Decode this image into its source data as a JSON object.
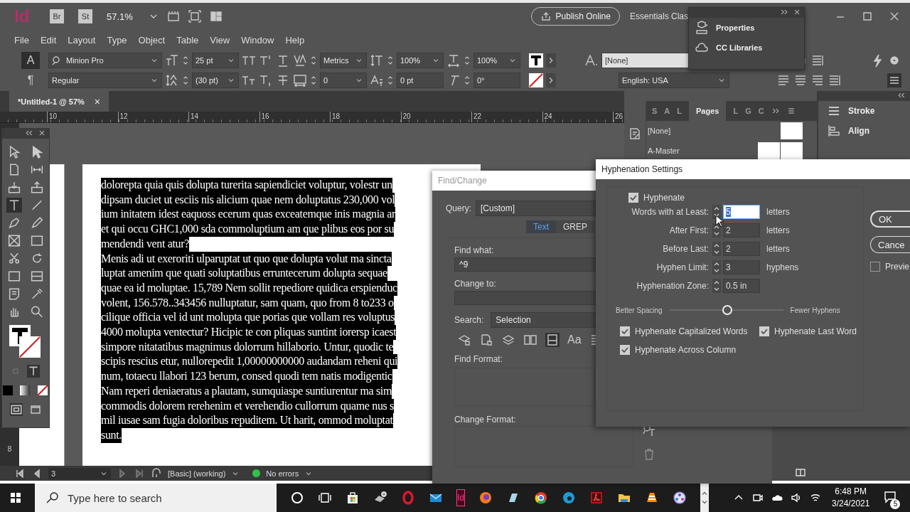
{
  "app_bar": {
    "logo": "Id",
    "bridge": "Br",
    "stock": "St",
    "zoom": "57.1%",
    "publish": "Publish Online",
    "workspace": "Essentials Clas"
  },
  "menu": [
    "File",
    "Edit",
    "Layout",
    "Type",
    "Object",
    "Table",
    "View",
    "Window",
    "Help"
  ],
  "control_panel": {
    "char_mode": "A",
    "para_mode": "¶",
    "font": "Minion Pro",
    "style": "Regular",
    "size": "25 pt",
    "leading": "(30 pt)",
    "kerning": "Metrics",
    "tracking": "0",
    "vertical_scale": "100%",
    "horizontal_scale": "100%",
    "baseline_shift": "0 pt",
    "skew": "0°",
    "char_style": "[None]",
    "language": "English: USA"
  },
  "popup_panel": {
    "items": [
      "Properties",
      "CC Libraries"
    ]
  },
  "doc_tab": {
    "title": "*Untitled-1 @ 57%",
    "close": "×"
  },
  "ruler": [
    "10",
    "12",
    "14",
    "16",
    "18",
    "20",
    "22",
    "24",
    "26"
  ],
  "vertical_ruler": "8",
  "text_frame": {
    "lines": [
      {
        "text": "dolorepta quia quis dolupta turerita sapiendiciet voluptur, volestr un"
      },
      {
        "text": "dipsam duciet ut esciis nis alicium quae nem doluptatus 230,000 vol"
      },
      {
        "text": "ium initatem idest eaquoss ecerum quas exceatemque inis magnia ar"
      },
      {
        "text": "et qui occu GHC1,000 sda commoluptium am que plibus eos por su"
      },
      {
        "text": "mendendi vent atur?"
      },
      {
        "text": "Menis adi ut exeroriti ulparuptat ut quo que dolupta volut ma sincta"
      },
      {
        "text": "luptat amenim que quati soluptatibus erruntecerum dolupta sequae"
      },
      {
        "text": "quae ea id moluptae. 15,789 Nem sollit repediore quidica erspienduc"
      },
      {
        "text": "volent, 156.578..343456  nulluptatur, sam quam, quo from 8 to233 o"
      },
      {
        "text": "cilique officia vel id unt molupta que porias que vollam res voluptus"
      },
      {
        "text": "4000 molupta ventectur? Hicipic te con pliquas suntint iorersp icaest"
      },
      {
        "text": "simpore nitatatibus magnimus dolorrum hillaborio. Untur, quodic te"
      },
      {
        "text": "scipis rescius etur, nullorepedit 1,00000000000 audandam reheni qui"
      },
      {
        "text": "num, totaecu llabori 123 berum, consed quodi tem natis modigentic"
      },
      {
        "text": "Nam reperi deniaeratus a plautam, sumquiaspe suntiurentur ma sim"
      },
      {
        "text": "commodis dolorem rerehenim et verehendio cullorrum quame nus s"
      },
      {
        "text": "mil iusae sam fugia doloribus repuditem. Ut harit, ommod moluptat"
      },
      {
        "text": "sunt."
      }
    ]
  },
  "pages_panel": {
    "tabs": [
      {
        "label": "S",
        "selected": false
      },
      {
        "label": "A",
        "selected": false
      },
      {
        "label": "L",
        "selected": false
      },
      {
        "label": "Pages",
        "selected": true
      },
      {
        "label": "L",
        "selected": false
      },
      {
        "label": "G",
        "selected": false
      },
      {
        "label": "C",
        "selected": false
      }
    ],
    "items": [
      {
        "name": "[None]"
      },
      {
        "name": "A-Master"
      }
    ]
  },
  "side_panels": [
    "Stroke",
    "Align"
  ],
  "find_change": {
    "title": "Find/Change",
    "query_label": "Query:",
    "query": "[Custom]",
    "tabs": [
      {
        "label": "Text",
        "selected": true
      },
      {
        "label": "GREP",
        "selected": false
      }
    ],
    "find_label": "Find what:",
    "find_value": "^9",
    "change_label": "Change to:",
    "search_label": "Search:",
    "search": "Selection",
    "options_label": "Aa",
    "find_format_label": "Find Format:",
    "change_format_label": "Change Format:"
  },
  "hyphenation": {
    "title": "Hyphenation Settings",
    "hyphenate": {
      "label": "Hyphenate",
      "checked": true
    },
    "fields": [
      {
        "label": "Words with at Least:",
        "value": "5",
        "unit": "letters",
        "selected": true
      },
      {
        "label": "After First:",
        "value": "2",
        "unit": "letters",
        "selected": false
      },
      {
        "label": "Before Last:",
        "value": "2",
        "unit": "letters",
        "selected": false
      },
      {
        "label": "Hyphen Limit:",
        "value": "3",
        "unit": "hyphens",
        "selected": false
      },
      {
        "label": "Hyphenation Zone:",
        "value": "0.5 in",
        "selected": false
      }
    ],
    "slider": {
      "left": "Better Spacing",
      "right": "Fewer Hyphens",
      "level": 0.5
    },
    "options": [
      {
        "label": "Hyphenate Capitalized Words",
        "checked": true
      },
      {
        "label": "Hyphenate Last Word",
        "checked": true
      },
      {
        "label": "Hyphenate Across Column",
        "checked": true
      }
    ],
    "buttons": [
      "OK",
      "Cance"
    ],
    "preview": {
      "label": "Previe",
      "checked": false
    }
  },
  "status_bar": {
    "page": "3",
    "profile": "[Basic] (working)",
    "errors": "No errors"
  },
  "taskbar": {
    "search_placeholder": "Type here to search",
    "app_label": "Id",
    "time": "6:48 PM",
    "date": "3/24/2021",
    "notifications": "5"
  }
}
